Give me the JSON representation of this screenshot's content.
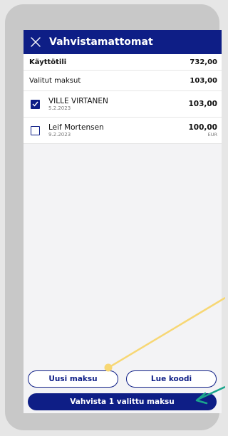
{
  "header": {
    "title": "Vahvistamattomat",
    "close_icon": "close-icon"
  },
  "summary": {
    "account_label": "Käyttötili",
    "account_value": "732,00",
    "selected_label": "Valitut maksut",
    "selected_value": "103,00"
  },
  "payments": [
    {
      "name": "VILLE VIRTANEN",
      "date": "5.2.2023",
      "amount": "103,00",
      "currency": "",
      "checked": true
    },
    {
      "name": "Leif Mortensen",
      "date": "9.2.2023",
      "amount": "100,00",
      "currency": "EUR",
      "checked": false
    }
  ],
  "buttons": {
    "new_payment": "Uusi maksu",
    "read_code": "Lue koodi",
    "confirm": "Vahvista 1 valittu maksu"
  },
  "colors": {
    "brand": "#0e1e86",
    "annotation_yellow": "#f7d774",
    "annotation_teal": "#1aa58c"
  }
}
